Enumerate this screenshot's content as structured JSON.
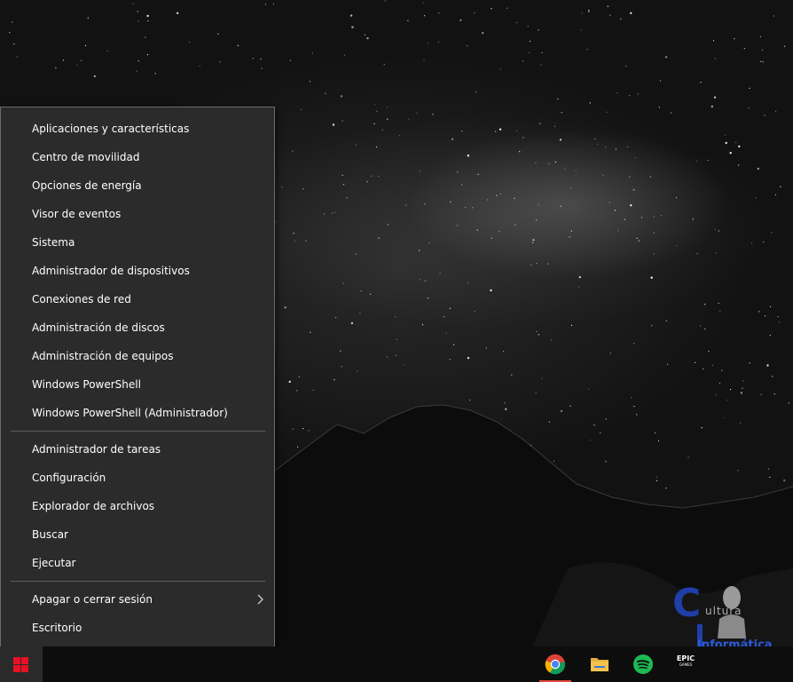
{
  "context_menu": {
    "groups": [
      {
        "items": [
          {
            "label": "Aplicaciones y características"
          },
          {
            "label": "Centro de movilidad"
          },
          {
            "label": "Opciones de energía"
          },
          {
            "label": "Visor de eventos"
          },
          {
            "label": "Sistema"
          },
          {
            "label": "Administrador de dispositivos"
          },
          {
            "label": "Conexiones de red"
          },
          {
            "label": "Administración de discos"
          },
          {
            "label": "Administración de equipos"
          },
          {
            "label": "Windows PowerShell"
          },
          {
            "label": "Windows PowerShell (Administrador)"
          }
        ]
      },
      {
        "items": [
          {
            "label": "Administrador de tareas"
          },
          {
            "label": "Configuración"
          },
          {
            "label": "Explorador de archivos"
          },
          {
            "label": "Buscar"
          },
          {
            "label": "Ejecutar"
          }
        ]
      },
      {
        "items": [
          {
            "label": "Apagar o cerrar sesión",
            "submenu": true,
            "icon": "chevron-right-icon"
          },
          {
            "label": "Escritorio"
          }
        ]
      }
    ]
  },
  "taskbar": {
    "start_icon": "windows-logo-icon",
    "start_color": "#e81123",
    "apps": [
      {
        "name": "chrome",
        "icon": "chrome-icon",
        "active": true
      },
      {
        "name": "file-explorer",
        "icon": "folder-icon",
        "active": false
      },
      {
        "name": "spotify",
        "icon": "spotify-icon",
        "active": false
      },
      {
        "name": "epic-games",
        "icon": "epic-games-icon",
        "label": "EPIC",
        "sublabel": "GAMES",
        "active": false
      }
    ]
  },
  "watermark": {
    "letter": "C",
    "word1": "ultura",
    "word2": "Informática",
    "color": "#1e3fa8"
  }
}
